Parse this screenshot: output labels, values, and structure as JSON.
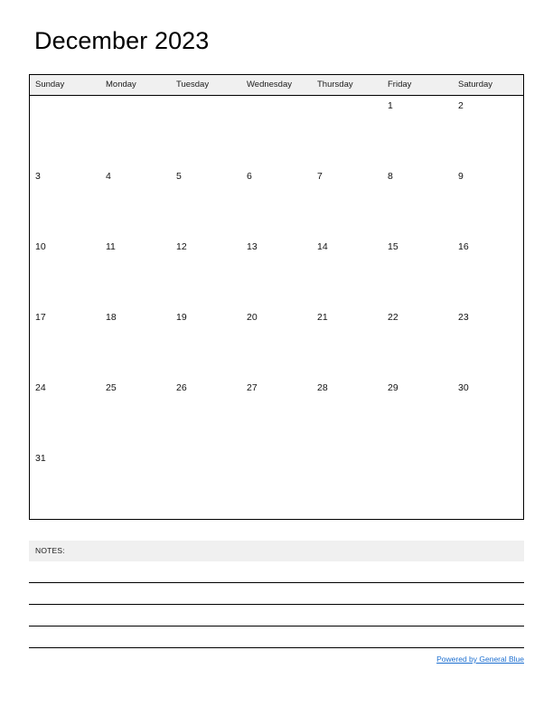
{
  "document": {
    "title": "December 2023",
    "month": "December",
    "year": "2023"
  },
  "calendar": {
    "weekdays": [
      "Sunday",
      "Monday",
      "Tuesday",
      "Wednesday",
      "Thursday",
      "Friday",
      "Saturday"
    ],
    "weeks": [
      [
        "",
        "",
        "",
        "",
        "",
        "1",
        "2"
      ],
      [
        "3",
        "4",
        "5",
        "6",
        "7",
        "8",
        "9"
      ],
      [
        "10",
        "11",
        "12",
        "13",
        "14",
        "15",
        "16"
      ],
      [
        "17",
        "18",
        "19",
        "20",
        "21",
        "22",
        "23"
      ],
      [
        "24",
        "25",
        "26",
        "27",
        "28",
        "29",
        "30"
      ],
      [
        "31",
        "",
        "",
        "",
        "",
        "",
        ""
      ]
    ]
  },
  "notes": {
    "label": "NOTES:",
    "line_count": 4
  },
  "footer": {
    "link_text": "Powered by General Blue"
  },
  "colors": {
    "header_background": "#f0f0f0",
    "notes_background": "#f0f0f0",
    "border": "#000000",
    "link": "#1d6fd0",
    "text": "#000000",
    "page_background": "#ffffff"
  }
}
